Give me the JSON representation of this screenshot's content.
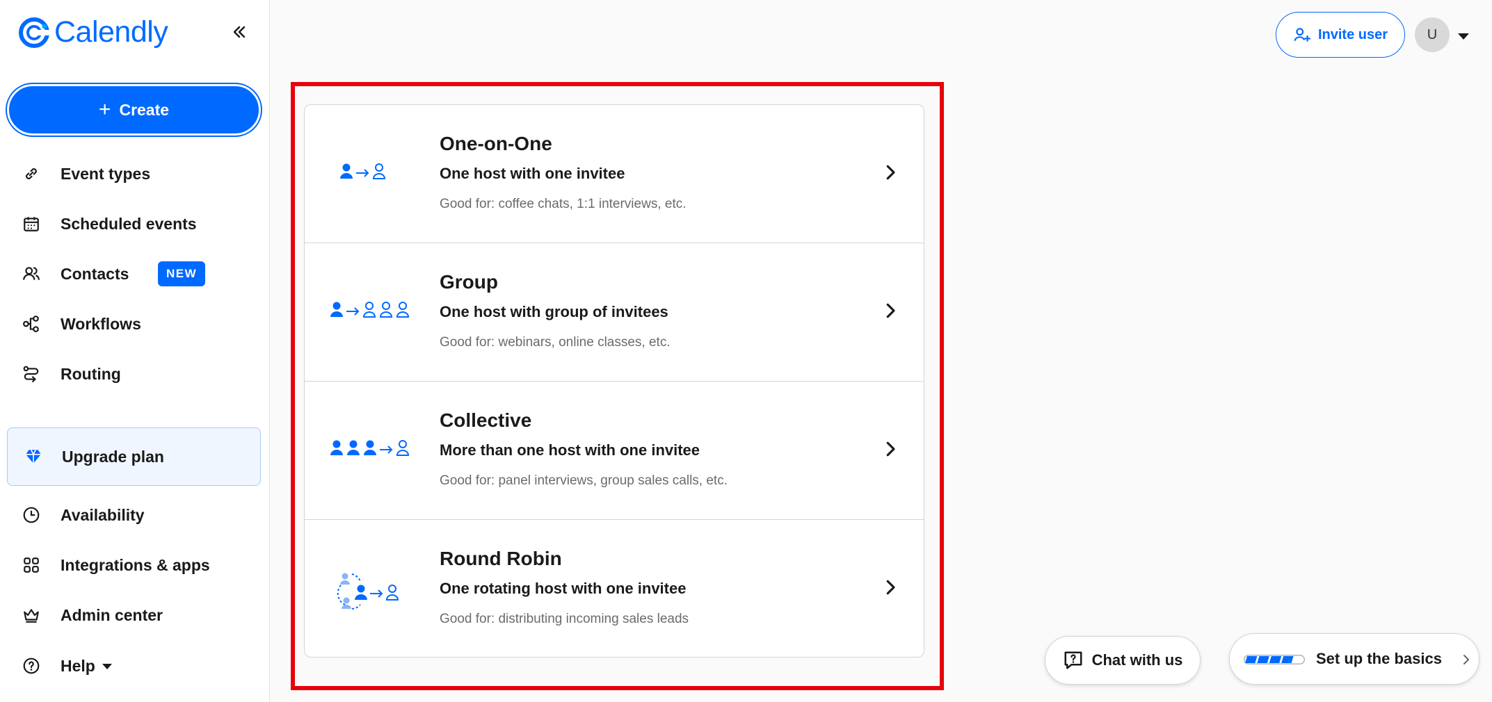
{
  "brand": {
    "name": "Calendly",
    "color": "#006bff"
  },
  "sidebar": {
    "collapse_icon": "double-chevron-left-icon",
    "create_label": "Create",
    "items": [
      {
        "label": "Event types",
        "icon": "link-icon"
      },
      {
        "label": "Scheduled events",
        "icon": "calendar-icon"
      },
      {
        "label": "Contacts",
        "icon": "contacts-icon",
        "badge": "NEW"
      },
      {
        "label": "Workflows",
        "icon": "workflow-icon"
      },
      {
        "label": "Routing",
        "icon": "routing-icon"
      }
    ],
    "upgrade_label": "Upgrade plan",
    "items2": [
      {
        "label": "Availability",
        "icon": "clock-icon"
      },
      {
        "label": "Integrations & apps",
        "icon": "grid-icon"
      },
      {
        "label": "Admin center",
        "icon": "crown-icon"
      },
      {
        "label": "Help",
        "icon": "help-icon"
      }
    ]
  },
  "header": {
    "invite_label": "Invite user",
    "avatar_initial": "U"
  },
  "event_options": [
    {
      "title": "One-on-One",
      "subtitle": "One host with one invitee",
      "description": "Good for: coffee chats, 1:1 interviews, etc."
    },
    {
      "title": "Group",
      "subtitle": "One host with group of invitees",
      "description": "Good for: webinars, online classes, etc."
    },
    {
      "title": "Collective",
      "subtitle": "More than one host with one invitee",
      "description": "Good for: panel interviews, group sales calls, etc."
    },
    {
      "title": "Round Robin",
      "subtitle": "One rotating host with one invitee",
      "description": "Good for: distributing incoming sales leads"
    }
  ],
  "widgets": {
    "chat_label": "Chat with us",
    "setup_label": "Set up the basics",
    "setup_progress": 0.8
  }
}
